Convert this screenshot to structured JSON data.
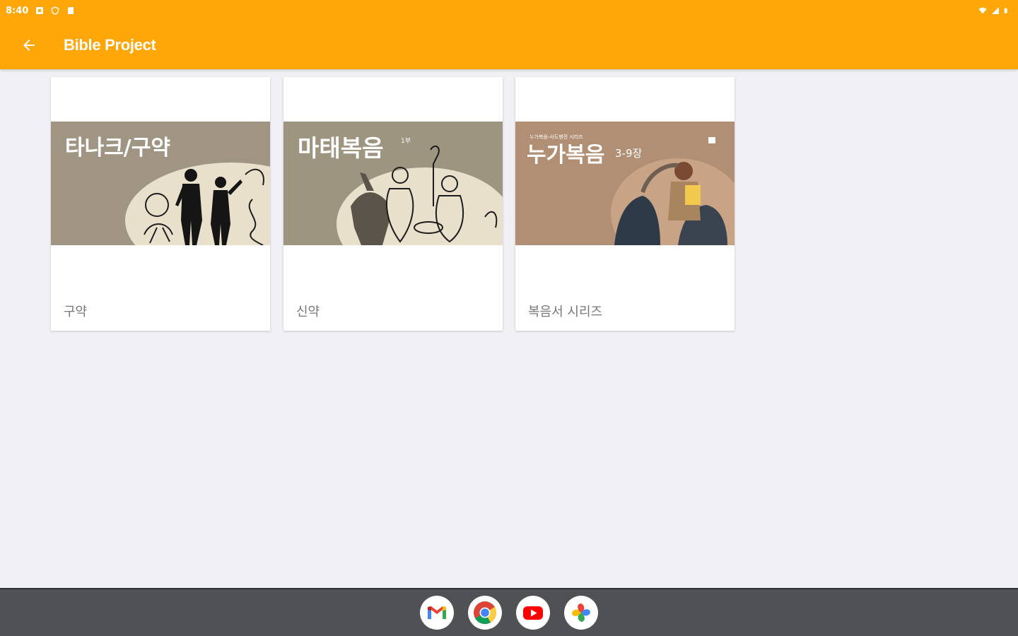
{
  "status_bar": {
    "time": "8:40",
    "left_icons": [
      "notification-icon",
      "shield-icon",
      "sd-card-icon"
    ],
    "right_icons": [
      "wifi-icon",
      "signal-icon",
      "battery-icon"
    ]
  },
  "app_bar": {
    "back_icon": "arrow-back-icon",
    "title": "Bible Project"
  },
  "cards": [
    {
      "image_title": "타나크/구약",
      "image_superscript": "",
      "label": "구약",
      "image_bg": "#a09582"
    },
    {
      "image_title": "마태복음",
      "image_superscript": "1부",
      "label": "신약",
      "image_bg": "#9e9580"
    },
    {
      "image_title": "누가복음",
      "image_superscript": "3-9장",
      "image_small_text": "누가복음-사도행전 시리즈",
      "label": "복음서 시리즈",
      "image_bg": "#b08f74"
    }
  ],
  "taskbar": {
    "apps": [
      "gmail-icon",
      "chrome-icon",
      "youtube-icon",
      "photos-icon"
    ]
  },
  "colors": {
    "accent": "#ffa709",
    "background": "#f1f1f5",
    "taskbar": "#505154"
  }
}
